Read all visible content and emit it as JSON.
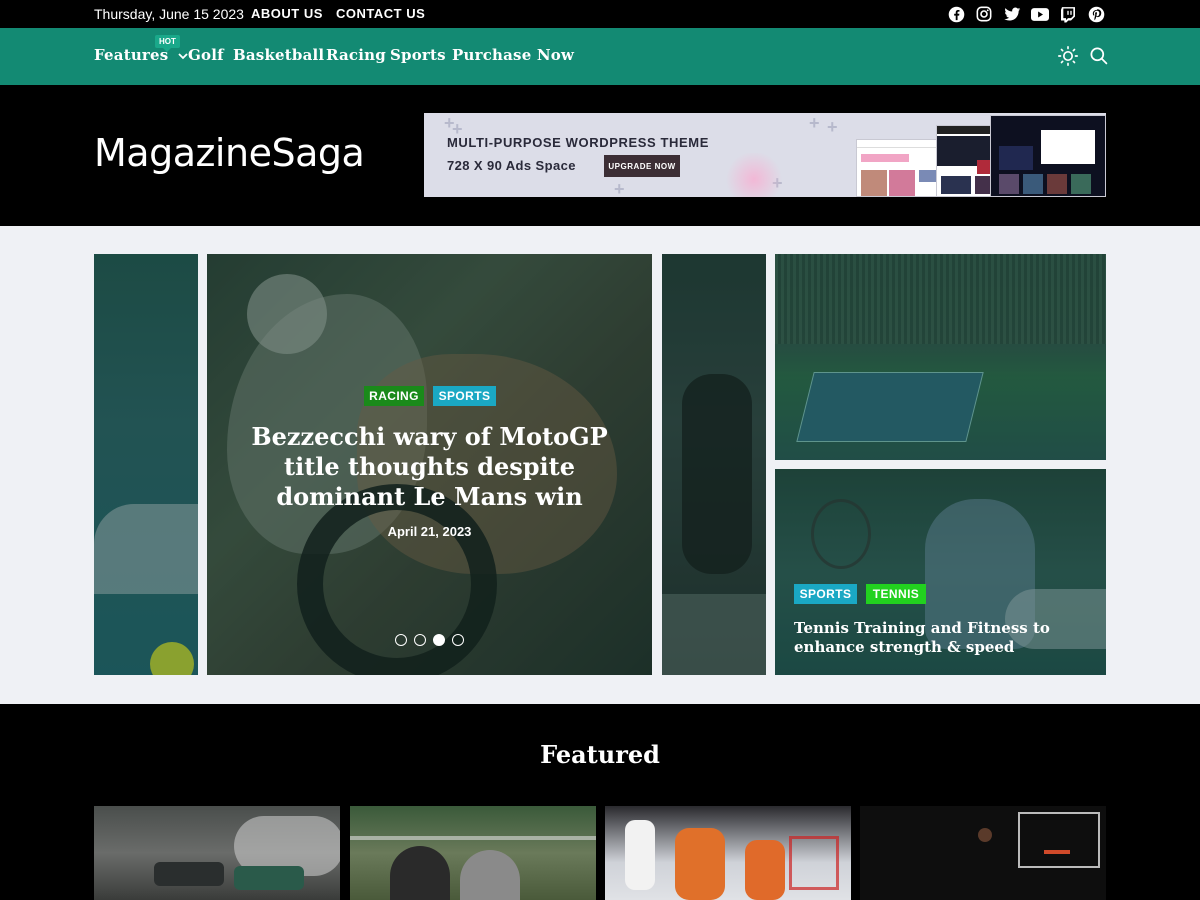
{
  "topbar": {
    "date": "Thursday, June 15 2023",
    "links": [
      "ABOUT US",
      "CONTACT US"
    ],
    "social_icons": [
      "facebook-icon",
      "instagram-icon",
      "twitter-icon",
      "youtube-icon",
      "twitch-icon",
      "pinterest-icon"
    ]
  },
  "nav": {
    "items": [
      "Features",
      "Golf",
      "Basketball",
      "Racing",
      "Sports",
      "Purchase Now"
    ],
    "hot_badge": "HOT",
    "icons": [
      "sun-icon",
      "search-icon"
    ]
  },
  "header": {
    "logo": "MagazineSaga",
    "ad": {
      "title": "MULTI-PURPOSE WORDPRESS THEME",
      "subtitle": "728 X 90 Ads Space",
      "button": "UPGRADE NOW"
    }
  },
  "hero": {
    "main_slide": {
      "tags": [
        "RACING",
        "SPORTS"
      ],
      "title": "Bezzecchi wary of MotoGP title thoughts despite dominant Le Mans win",
      "date": "April 21, 2023"
    },
    "side_post": {
      "tags": [
        "SPORTS",
        "TENNIS"
      ],
      "title": "Tennis Training and Fitness to enhance strength & speed"
    },
    "dots_total": 4,
    "dots_active": 3
  },
  "featured": {
    "heading": "Featured"
  },
  "colors": {
    "nav_green": "#138a73",
    "tag_racing": "#1a8a1a",
    "tag_sports": "#1aa8c4",
    "tag_tennis": "#22d11f"
  }
}
